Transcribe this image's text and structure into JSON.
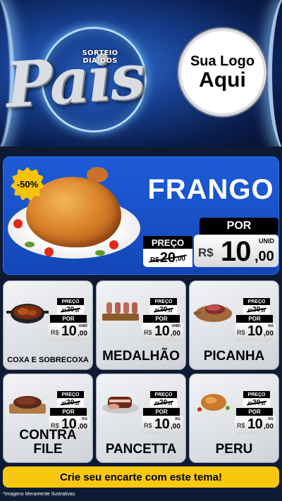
{
  "header": {
    "logo_top_line1": "SORTEIO",
    "logo_top_line2": "DIA DOS",
    "logo_main": "Pais",
    "placeholder_line1": "Sua Logo",
    "placeholder_line2": "Aqui"
  },
  "hero": {
    "discount_badge": "-50%",
    "product": "FRANGO",
    "old_label": "PREÇO",
    "old_currency": "R$",
    "old_int": "20",
    "old_dec": ",00",
    "new_label": "POR",
    "new_currency": "R$",
    "new_int": "10",
    "new_dec": ",00",
    "unit": "UNID"
  },
  "products": [
    {
      "name": "COXA E SOBRECOXA",
      "old_label": "PREÇO",
      "old_currency": "R$",
      "old_int": "20",
      "old_dec": ",00",
      "new_label": "POR",
      "new_currency": "R$",
      "new_int": "10",
      "new_dec": ",00",
      "unit": "UNID"
    },
    {
      "name": "MEDALHÃO",
      "old_label": "PREÇO",
      "old_currency": "R$",
      "old_int": "20",
      "old_dec": ",00",
      "new_label": "POR",
      "new_currency": "R$",
      "new_int": "10",
      "new_dec": ",00",
      "unit": "UNID"
    },
    {
      "name": "PICANHA",
      "old_label": "PREÇO",
      "old_currency": "R$",
      "old_int": "20",
      "old_dec": ",00",
      "new_label": "POR",
      "new_currency": "R$",
      "new_int": "10",
      "new_dec": ",00",
      "unit": "KG"
    },
    {
      "name": "CONTRA FILE",
      "old_label": "PREÇO",
      "old_currency": "R$",
      "old_int": "20",
      "old_dec": ",00",
      "new_label": "POR",
      "new_currency": "R$",
      "new_int": "10",
      "new_dec": ",00",
      "unit": "KG"
    },
    {
      "name": "PANCETTA",
      "old_label": "PREÇO",
      "old_currency": "R$",
      "old_int": "20",
      "old_dec": ",00",
      "new_label": "POR",
      "new_currency": "R$",
      "new_int": "10",
      "new_dec": ",00",
      "unit": "KG"
    },
    {
      "name": "PERU",
      "old_label": "PREÇO",
      "old_currency": "R$",
      "old_int": "20",
      "old_dec": ",00",
      "new_label": "POR",
      "new_currency": "R$",
      "new_int": "10",
      "new_dec": ",00",
      "unit": "KG"
    }
  ],
  "footer": {
    "cta": "Crie seu encarte com este tema!",
    "note": "*Imagens Meramente Ilustrativas"
  },
  "colors": {
    "hero_blue": "#1e5bd8",
    "cta_yellow": "#f7c80e",
    "badge_yellow": "#f5c40a"
  }
}
